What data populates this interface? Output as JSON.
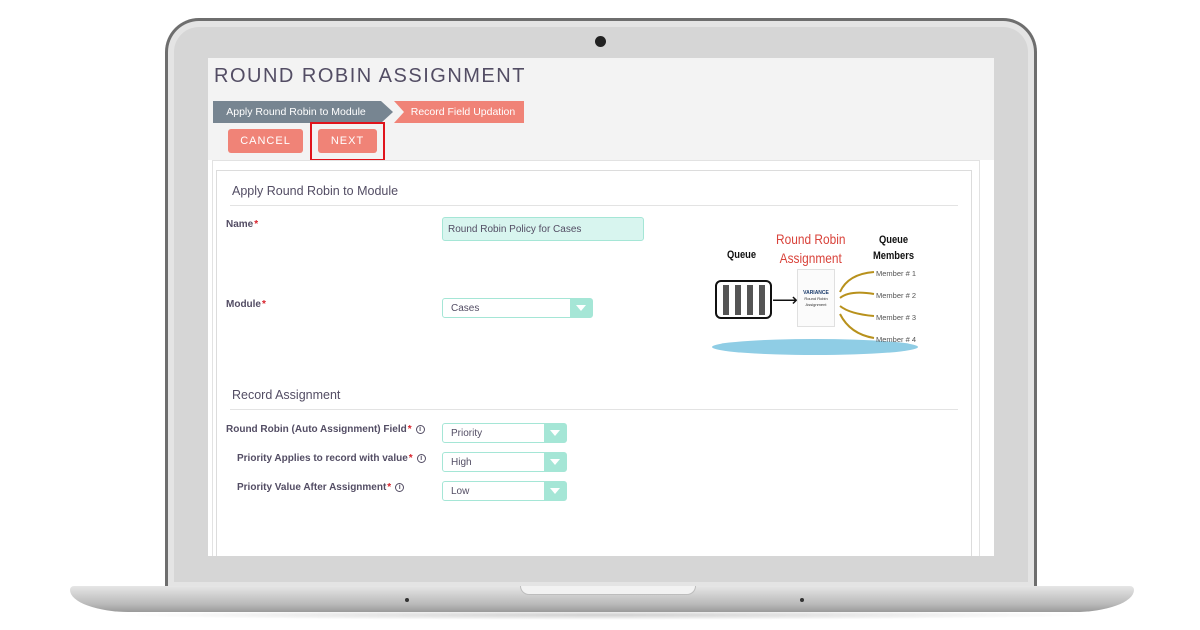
{
  "page": {
    "title": "ROUND ROBIN ASSIGNMENT"
  },
  "steps": [
    {
      "label": "Apply Round Robin to Module",
      "state": "completed"
    },
    {
      "label": "Record Field Updation",
      "state": "active"
    }
  ],
  "actions": {
    "cancel_label": "CANCEL",
    "next_label": "NEXT"
  },
  "sections": {
    "module": {
      "title": "Apply Round Robin to Module",
      "name_label": "Name",
      "name_value": "Round Robin Policy for Cases",
      "module_label": "Module",
      "module_value": "Cases"
    },
    "record": {
      "title": "Record Assignment",
      "fields": [
        {
          "label": "Round Robin (Auto Assignment) Field",
          "value": "Priority"
        },
        {
          "label": "Priority Applies to record with value",
          "value": "High"
        },
        {
          "label": "Priority Value After Assignment",
          "value": "Low"
        }
      ]
    }
  },
  "required_marker": "*",
  "info_glyph": "i",
  "diagram": {
    "queue_label": "Queue",
    "title_line1": "Round Robin",
    "title_line2": "Assignment",
    "members_line1": "Queue",
    "members_line2": "Members",
    "card_brand": "VARIANCE",
    "card_caption": "Round Robin Assignment",
    "members": [
      "Member # 1",
      "Member # 2",
      "Member # 3",
      "Member # 4"
    ]
  },
  "colors": {
    "accent": "#f08377",
    "step_done": "#778591",
    "input_bg": "#d8f5ef",
    "input_border": "#a5e6d6",
    "highlight": "#e0141c",
    "text": "#534d64"
  }
}
